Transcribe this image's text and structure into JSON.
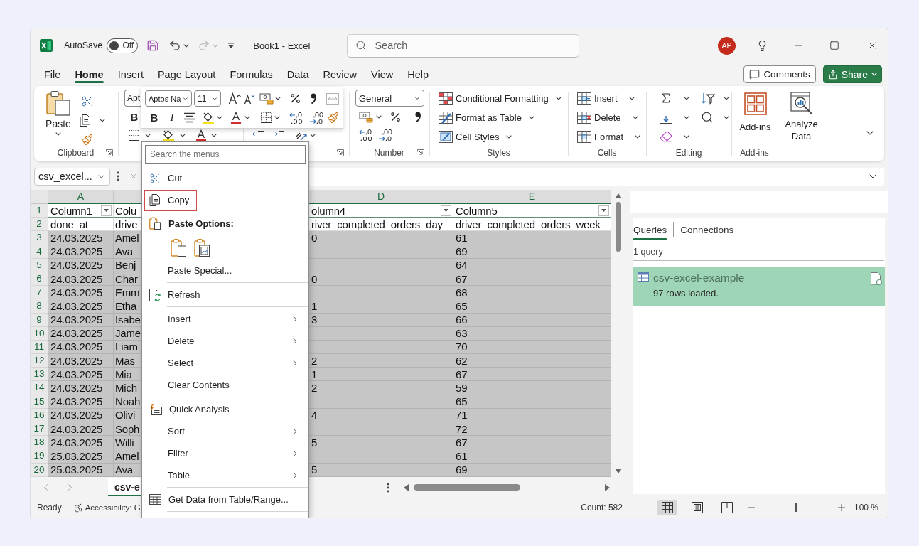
{
  "title_bar": {
    "autosave_label": "AutoSave",
    "autosave": {
      "on": false,
      "state_label": "Off"
    },
    "redo_disabled": true,
    "document_title": "Book1 - Excel",
    "search": {
      "placeholder": "Search"
    },
    "account_initials": "AP"
  },
  "ribbon_tabs": [
    {
      "label": "File",
      "selected": false
    },
    {
      "label": "Home",
      "selected": true
    },
    {
      "label": "Insert",
      "selected": false
    },
    {
      "label": "Page Layout",
      "selected": false
    },
    {
      "label": "Formulas",
      "selected": false
    },
    {
      "label": "Data",
      "selected": false
    },
    {
      "label": "Review",
      "selected": false
    },
    {
      "label": "View",
      "selected": false
    },
    {
      "label": "Help",
      "selected": false
    }
  ],
  "ribbon_actions": {
    "comments": "Comments",
    "share": "Share"
  },
  "ribbon": {
    "clipboard": {
      "paste": "Paste",
      "label": "Clipboard"
    },
    "font": {
      "font_name": "Apt",
      "bold": "B"
    },
    "number": {
      "format": "General",
      "label": "Number"
    },
    "styles": {
      "commands": [
        "Conditional Formatting",
        "Format as Table",
        "Cell Styles"
      ],
      "label": "Styles"
    },
    "cells": {
      "commands": [
        "Insert",
        "Delete",
        "Format"
      ],
      "label": "Cells"
    },
    "editing": {
      "label": "Editing"
    },
    "add_ins": {
      "button": "Add-ins",
      "label": "Add-ins"
    },
    "analyze_data": {
      "button": "Analyze Data"
    }
  },
  "mini_toolbar": {
    "font_name": "Aptos Na",
    "font_size": "11",
    "bold": "B",
    "italic": "I",
    "merge_disabled": true
  },
  "formula_bar": {
    "name_box": "csv_excel..."
  },
  "grid": {
    "columns": [
      {
        "header": "A",
        "selected": true,
        "filter": true
      },
      {
        "selected": true,
        "filter": false
      },
      {
        "header": "D",
        "selected": true,
        "filter": true
      },
      {
        "header": "E",
        "selected": true,
        "filter": true
      }
    ],
    "rows": [
      {
        "number": "1",
        "kind": "header",
        "selected": false,
        "column_a": "Column1",
        "column_b": "Colu",
        "column_d": "olumn4",
        "column_e": "Column5"
      },
      {
        "number": "2",
        "kind": "data",
        "selected": false,
        "column_a": "done_at",
        "column_b": "drive",
        "column_d": "river_completed_orders_day",
        "column_e": "driver_completed_orders_week"
      },
      {
        "number": "3",
        "kind": "data",
        "selected": true,
        "column_a": "24.03.2025",
        "column_b": "Amel",
        "column_d": "0",
        "column_e": "61"
      },
      {
        "number": "4",
        "kind": "data",
        "selected": true,
        "column_a": "24.03.2025",
        "column_b": "Ava",
        "column_e": "69"
      },
      {
        "number": "5",
        "kind": "data",
        "selected": true,
        "column_a": "24.03.2025",
        "column_b": "Benj",
        "column_e": "64"
      },
      {
        "number": "6",
        "kind": "data",
        "selected": true,
        "column_a": "24.03.2025",
        "column_b": "Char",
        "column_d": "0",
        "column_e": "67"
      },
      {
        "number": "7",
        "kind": "data",
        "selected": true,
        "column_a": "24.03.2025",
        "column_b": "Emm",
        "column_e": "68"
      },
      {
        "number": "8",
        "kind": "data",
        "selected": true,
        "column_a": "24.03.2025",
        "column_b": "Etha",
        "column_d": "1",
        "column_e": "65"
      },
      {
        "number": "9",
        "kind": "data",
        "selected": true,
        "column_a": "24.03.2025",
        "column_b": "Isabe",
        "column_d": "3",
        "column_e": "66"
      },
      {
        "number": "10",
        "kind": "data",
        "selected": true,
        "column_a": "24.03.2025",
        "column_b": "Jame",
        "column_e": "63"
      },
      {
        "number": "11",
        "kind": "data",
        "selected": true,
        "column_a": "24.03.2025",
        "column_b": "Liam",
        "column_e": "70"
      },
      {
        "number": "12",
        "kind": "data",
        "selected": true,
        "column_a": "24.03.2025",
        "column_b": "Mas",
        "column_d": "2",
        "column_e": "62"
      },
      {
        "number": "13",
        "kind": "data",
        "selected": true,
        "column_a": "24.03.2025",
        "column_b": "Mia",
        "column_d": "1",
        "column_e": "67"
      },
      {
        "number": "14",
        "kind": "data",
        "selected": true,
        "column_a": "24.03.2025",
        "column_b": "Mich",
        "column_d": "2",
        "column_e": "59"
      },
      {
        "number": "15",
        "kind": "data",
        "selected": true,
        "column_a": "24.03.2025",
        "column_b": "Noah",
        "column_e": "65"
      },
      {
        "number": "16",
        "kind": "data",
        "selected": true,
        "column_a": "24.03.2025",
        "column_b": "Olivi",
        "column_d": "4",
        "column_e": "71"
      },
      {
        "number": "17",
        "kind": "data",
        "selected": true,
        "column_a": "24.03.2025",
        "column_b": "Soph",
        "column_e": "72"
      },
      {
        "number": "18",
        "kind": "data",
        "selected": true,
        "column_a": "24.03.2025",
        "column_b": "Willi",
        "column_d": "5",
        "column_e": "67"
      },
      {
        "number": "19",
        "kind": "data",
        "selected": true,
        "column_a": "25.03.2025",
        "column_b": "Amel",
        "column_e": "61"
      },
      {
        "number": "20",
        "kind": "data",
        "selected": true,
        "column_a": "25.03.2025",
        "column_b": "Ava",
        "column_d": "5",
        "column_e": "69"
      }
    ]
  },
  "sheet_tabs": [
    {
      "label": "csv-e",
      "selected": true
    }
  ],
  "queries_pane": {
    "tabs": [
      {
        "label": "Queries",
        "selected": true
      },
      {
        "label": "Connections",
        "selected": false
      }
    ],
    "count": "1 query",
    "queries": [
      {
        "name": "csv-excel-example",
        "status": "97 rows loaded.",
        "selected": true
      }
    ]
  },
  "status_bar": {
    "mode": "Ready",
    "accessibility": "Accessibility: G",
    "count": "Count: 582",
    "views": [
      {
        "selected": true
      },
      {
        "selected": false
      },
      {
        "selected": false
      }
    ],
    "zoom": {
      "level": 0.5,
      "label": "100 %"
    }
  },
  "context_menu": {
    "search_placeholder": "Search the menus",
    "items": [
      {
        "kind": "item",
        "label": "Cut",
        "highlighted": false
      },
      {
        "kind": "item",
        "label": "Copy",
        "highlighted": true
      },
      {
        "kind": "heading",
        "label": "Paste Options:"
      },
      {
        "kind": "paste_options"
      },
      {
        "kind": "item",
        "label": "Paste Special...",
        "highlighted": false
      },
      {
        "kind": "separator"
      },
      {
        "kind": "item",
        "label": "Refresh",
        "highlighted": false
      },
      {
        "kind": "separator"
      },
      {
        "kind": "submenu",
        "label": "Insert",
        "highlighted": false
      },
      {
        "kind": "submenu",
        "label": "Delete",
        "highlighted": false
      },
      {
        "kind": "submenu",
        "label": "Select",
        "highlighted": false
      },
      {
        "kind": "item",
        "label": "Clear Contents",
        "highlighted": false
      },
      {
        "kind": "separator"
      },
      {
        "kind": "item",
        "label": "Quick Analysis",
        "highlighted": false
      },
      {
        "kind": "submenu",
        "label": "Sort",
        "highlighted": false
      },
      {
        "kind": "submenu",
        "label": "Filter",
        "highlighted": false
      },
      {
        "kind": "submenu",
        "label": "Table",
        "highlighted": false
      },
      {
        "kind": "separator"
      },
      {
        "kind": "item",
        "label": "Get Data from Table/Range...",
        "highlighted": false
      },
      {
        "kind": "separator"
      }
    ]
  }
}
